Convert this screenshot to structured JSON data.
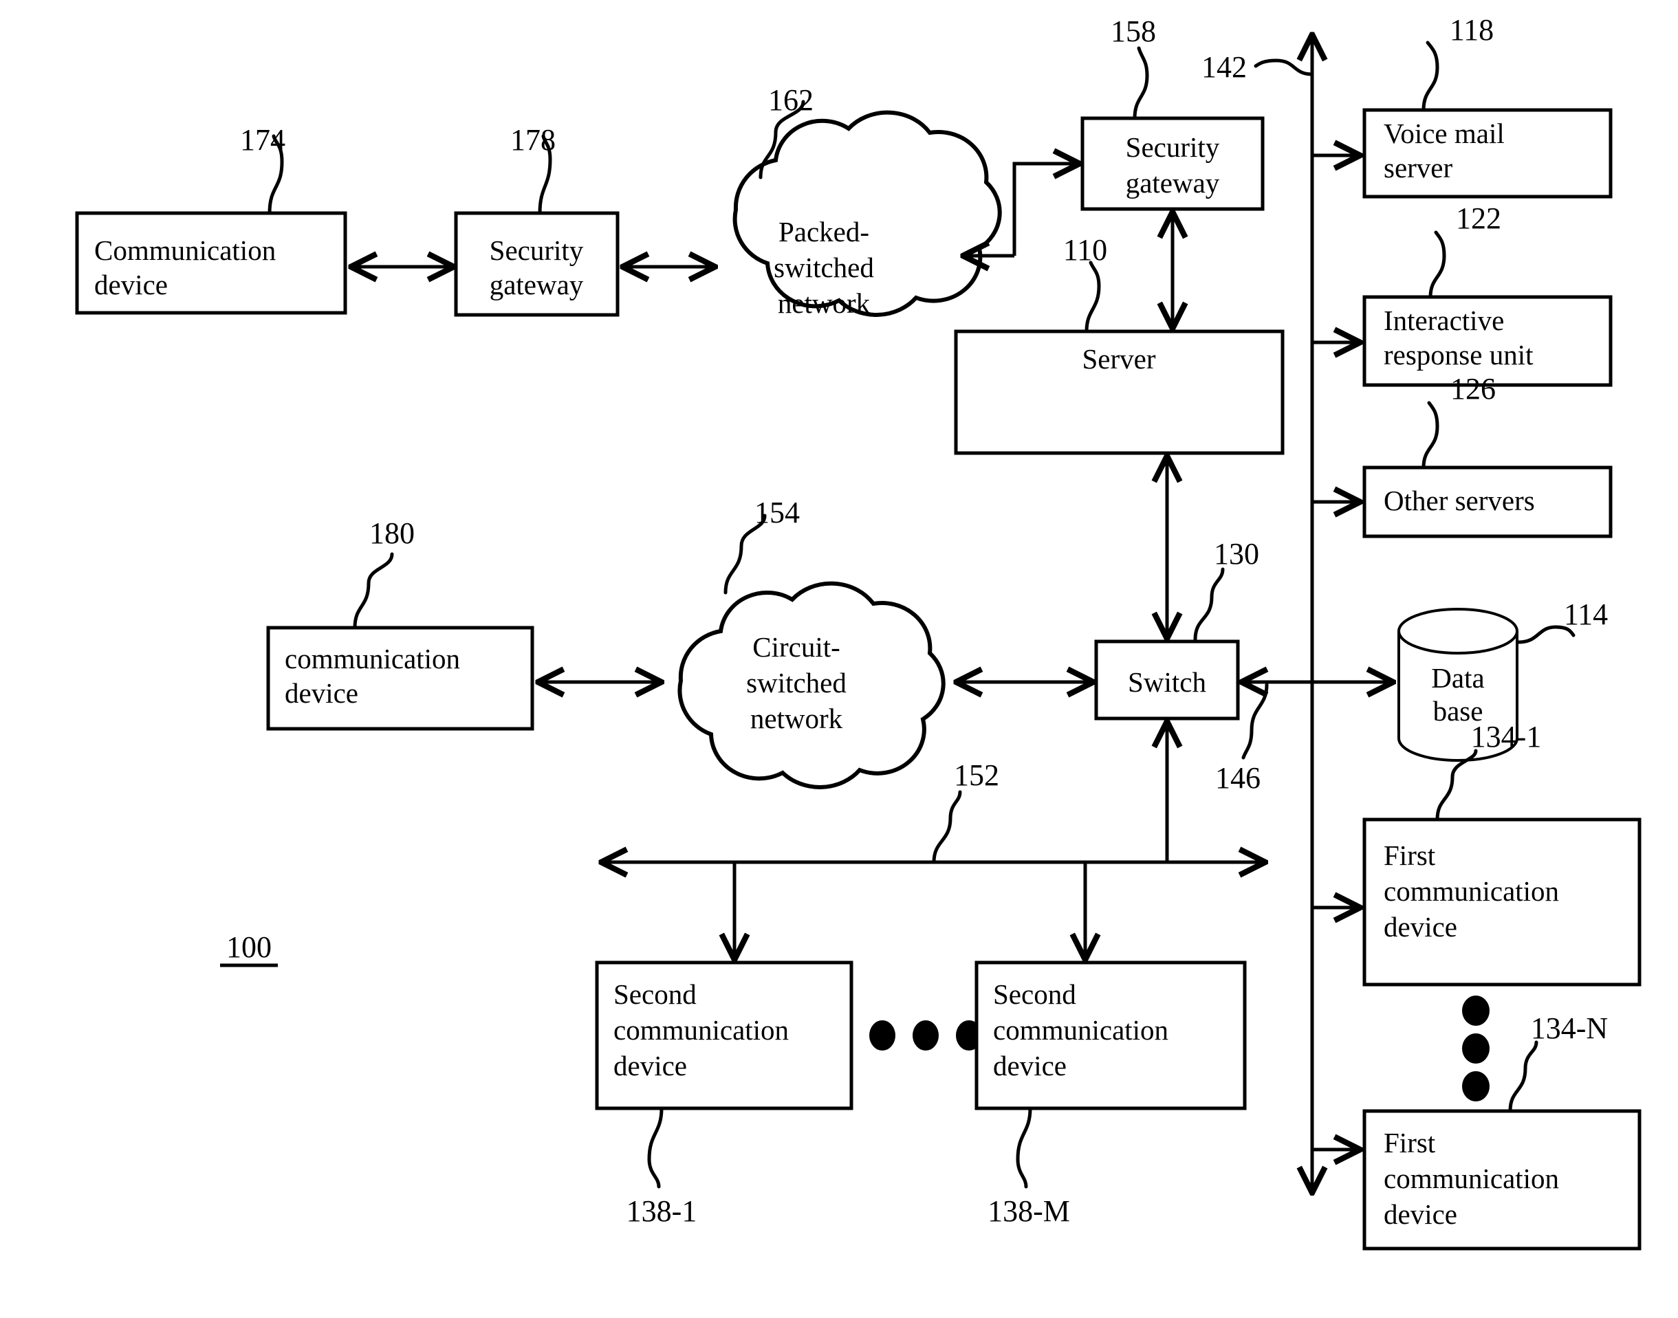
{
  "figure": {
    "system_label": "100",
    "boxes": [
      {
        "id": "comm-device-174",
        "label_lines": [
          "Communication",
          "device"
        ],
        "ref": "174"
      },
      {
        "id": "security-gateway-178",
        "label_lines": [
          "Security",
          "gateway"
        ],
        "ref": "178"
      },
      {
        "id": "packed-switched-network-162",
        "label_lines": [
          "Packed-",
          "switched",
          "network"
        ],
        "ref": "162"
      },
      {
        "id": "security-gateway-158",
        "label_lines": [
          "Security",
          "gateway"
        ],
        "ref": "158"
      },
      {
        "id": "server-110",
        "label_lines": [
          "Server"
        ],
        "ref": "110"
      },
      {
        "id": "voice-mail-server-118",
        "label_lines": [
          "Voice mail",
          "server"
        ],
        "ref": "118"
      },
      {
        "id": "interactive-response-unit-122",
        "label_lines": [
          "Interactive",
          "response unit"
        ],
        "ref": "122"
      },
      {
        "id": "other-servers-126",
        "label_lines": [
          "Other servers"
        ],
        "ref": "126"
      },
      {
        "id": "database-114",
        "label_lines": [
          "Data",
          "base"
        ],
        "ref": "114"
      },
      {
        "id": "switch-130",
        "label_lines": [
          "Switch"
        ],
        "ref": "130"
      },
      {
        "id": "circuit-switched-network-154",
        "label_lines": [
          "Circuit-",
          "switched",
          "network"
        ],
        "ref": "154"
      },
      {
        "id": "communication-device-180",
        "label_lines": [
          "communication",
          "device"
        ],
        "ref": "180"
      },
      {
        "id": "second-comm-device-138-1",
        "label_lines": [
          "Second",
          "communication",
          "device"
        ],
        "ref": "138-1"
      },
      {
        "id": "second-comm-device-138-M",
        "label_lines": [
          "Second",
          "communication",
          "device"
        ],
        "ref": "138-M"
      },
      {
        "id": "first-comm-device-134-1",
        "label_lines": [
          "First",
          "communication",
          "device"
        ],
        "ref": "134-1"
      },
      {
        "id": "first-comm-device-134-N",
        "label_lines": [
          "First",
          "communication",
          "device"
        ],
        "ref": "134-N"
      }
    ],
    "bus_refs": [
      {
        "id": "bus-142",
        "ref": "142"
      },
      {
        "id": "bus-146",
        "ref": "146"
      },
      {
        "id": "bus-152",
        "ref": "152"
      }
    ],
    "text": {
      "communication_device_cap": "Communication",
      "device": "device",
      "security": "Security",
      "gateway": "gateway",
      "packed_dash": "Packed-",
      "switched": "switched",
      "network": "network",
      "server": "Server",
      "voice_mail": "Voice mail",
      "server_lc": "server",
      "interactive": "Interactive",
      "response_unit": "response unit",
      "other_servers": "Other servers",
      "data": "Data",
      "base": "base",
      "switch": "Switch",
      "circuit_dash": "Circuit-",
      "communication_lc": "communication",
      "second": "Second",
      "communication": "communication",
      "first": "First",
      "ref_174": "174",
      "ref_178": "178",
      "ref_162": "162",
      "ref_158": "158",
      "ref_142": "142",
      "ref_118": "118",
      "ref_110": "110",
      "ref_122": "122",
      "ref_126": "126",
      "ref_130": "130",
      "ref_114": "114",
      "ref_146": "146",
      "ref_180": "180",
      "ref_154": "154",
      "ref_152": "152",
      "ref_100": "100",
      "ref_138_1": "138-1",
      "ref_138_M": "138-M",
      "ref_134_1": "134-1",
      "ref_134_N": "134-N"
    }
  }
}
